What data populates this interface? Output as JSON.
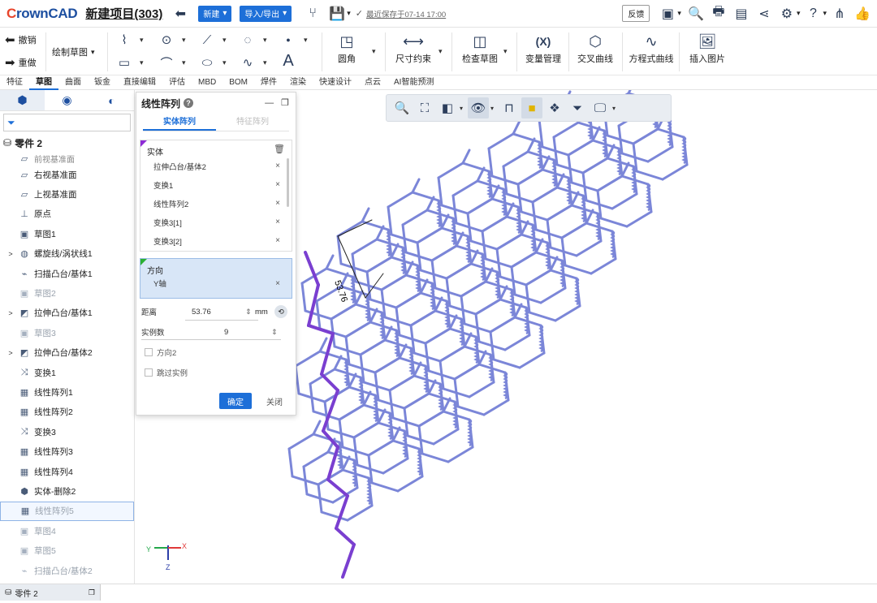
{
  "app": {
    "logo": "CrownCAD",
    "project_title": "新建项目(303)",
    "new_label": "新建",
    "import_export_label": "导入/导出",
    "save_status": "最近保存于07-14 17:00",
    "feedback_label": "反馈"
  },
  "ribbon": {
    "undo_label": "撤销",
    "redo_label": "重做",
    "sketch_label": "绘制草图",
    "fillet_label": "圆角",
    "dimension_label": "尺寸约束",
    "check_sketch_label": "检查草图",
    "variable_label": "变量管理",
    "variable_icon_text": "(X)",
    "intersect_curve_label": "交叉曲线",
    "equation_curve_label": "方程式曲线",
    "insert_image_label": "插入图片",
    "text_tool_glyph": "A"
  },
  "tabs": [
    "特征",
    "草图",
    "曲面",
    "钣金",
    "直接编辑",
    "评估",
    "MBD",
    "BOM",
    "焊件",
    "渲染",
    "快速设计",
    "点云",
    "AI智能预测"
  ],
  "active_tab": "草图",
  "tree": {
    "root_label": "零件 2",
    "items": [
      {
        "label": "前视基准面",
        "icon": "plane-icon",
        "state": "partial",
        "expand": ""
      },
      {
        "label": "右视基准面",
        "icon": "plane-icon",
        "state": "normal",
        "expand": ""
      },
      {
        "label": "上视基准面",
        "icon": "plane-icon",
        "state": "normal",
        "expand": ""
      },
      {
        "label": "原点",
        "icon": "origin-icon",
        "state": "normal",
        "expand": ""
      },
      {
        "label": "草图1",
        "icon": "sketch-icon",
        "state": "normal",
        "expand": ""
      },
      {
        "label": "螺旋线/涡状线1",
        "icon": "helix-icon",
        "state": "normal",
        "expand": ">"
      },
      {
        "label": "扫描凸台/基体1",
        "icon": "sweep-icon",
        "state": "normal",
        "expand": ""
      },
      {
        "label": "草图2",
        "icon": "sketch-icon",
        "state": "dim",
        "expand": ""
      },
      {
        "label": "拉伸凸台/基体1",
        "icon": "extrude-icon",
        "state": "normal",
        "expand": ">"
      },
      {
        "label": "草图3",
        "icon": "sketch-icon",
        "state": "dim",
        "expand": ""
      },
      {
        "label": "拉伸凸台/基体2",
        "icon": "extrude-icon",
        "state": "normal",
        "expand": ">"
      },
      {
        "label": "变换1",
        "icon": "transform-icon",
        "state": "normal",
        "expand": ""
      },
      {
        "label": "线性阵列1",
        "icon": "pattern-icon",
        "state": "normal",
        "expand": ""
      },
      {
        "label": "线性阵列2",
        "icon": "pattern-icon",
        "state": "normal",
        "expand": ""
      },
      {
        "label": "变换3",
        "icon": "transform-icon",
        "state": "normal",
        "expand": ""
      },
      {
        "label": "线性阵列3",
        "icon": "pattern-icon",
        "state": "normal",
        "expand": ""
      },
      {
        "label": "线性阵列4",
        "icon": "pattern-icon",
        "state": "normal",
        "expand": ""
      },
      {
        "label": "实体-删除2",
        "icon": "solid-icon",
        "state": "normal",
        "expand": ""
      },
      {
        "label": "线性阵列5",
        "icon": "pattern-icon",
        "state": "selected",
        "expand": ""
      },
      {
        "label": "草图4",
        "icon": "sketch-icon",
        "state": "dim",
        "expand": ""
      },
      {
        "label": "草图5",
        "icon": "sketch-icon",
        "state": "dim",
        "expand": ""
      },
      {
        "label": "扫描凸台/基体2",
        "icon": "sweep-icon",
        "state": "dim",
        "expand": ""
      }
    ]
  },
  "dialog": {
    "title": "线性阵列",
    "tab_entity": "实体阵列",
    "tab_feature": "特征阵列",
    "entity_header": "实体",
    "entities": [
      "拉伸凸台/基体2",
      "变换1",
      "线性阵列2",
      "变换3[1]",
      "变换3[2]"
    ],
    "direction_header": "方向",
    "direction_value": "Y轴",
    "distance_label": "距离",
    "distance_value": "53.76",
    "distance_unit": "mm",
    "count_label": "实例数",
    "count_value": "9",
    "direction2_label": "方向2",
    "skip_label": "跳过实例",
    "ok_label": "确定",
    "close_label": "关闭",
    "remove_glyph": "×"
  },
  "viewport": {
    "dimension_text": "53.76",
    "axis_x": "X",
    "axis_y": "Y",
    "axis_z": "Z"
  },
  "status": {
    "tab_label": "零件 2"
  },
  "colors": {
    "accent": "#1d6fd8",
    "mesh": "#7b86d8",
    "selected_edge": "#7a3fd0"
  }
}
